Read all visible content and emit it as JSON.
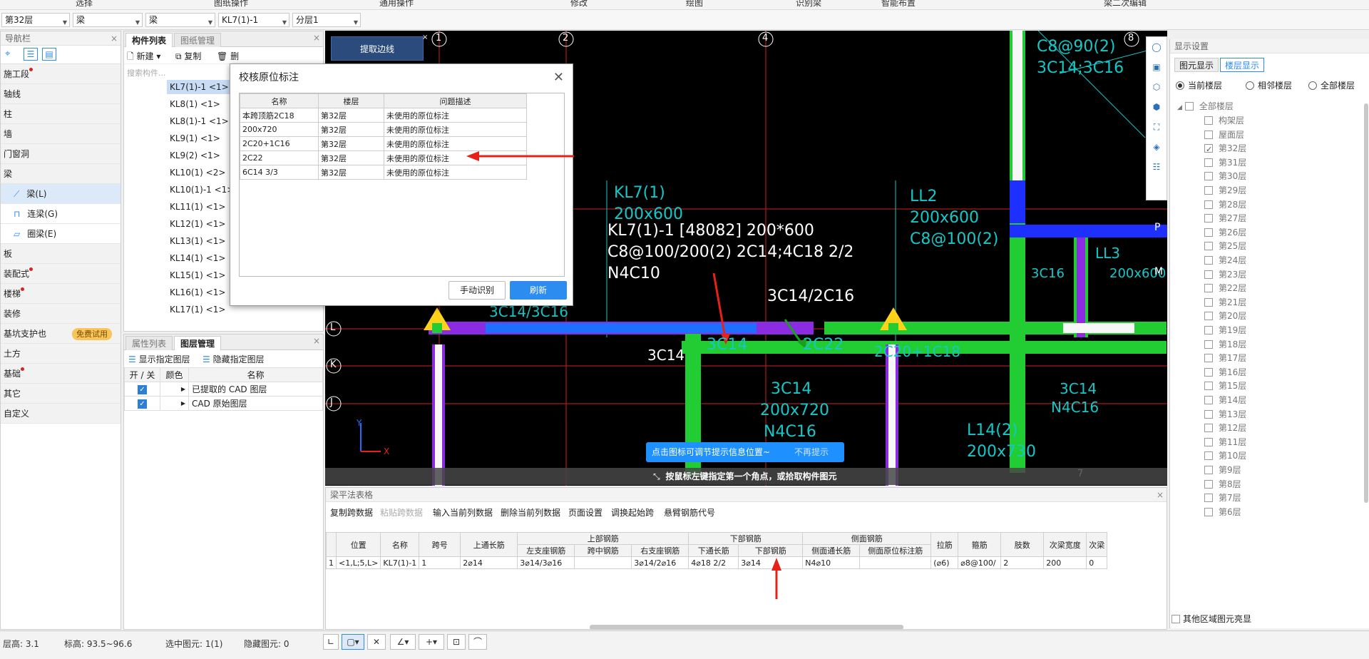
{
  "topmenu": [
    "选择",
    "图纸操作",
    "通用操作",
    "修改",
    "绘图",
    "识别梁",
    "智能布置",
    "梁二次编辑"
  ],
  "selectors": [
    "第32层",
    "梁",
    "梁",
    "KL7(1)-1",
    "分层1"
  ],
  "nav": {
    "title": "导航栏",
    "items": [
      {
        "label": "施工段",
        "dot": true
      },
      {
        "label": "轴线"
      },
      {
        "label": "柱"
      },
      {
        "label": "墙"
      },
      {
        "label": "门窗洞"
      },
      {
        "label": "梁"
      }
    ],
    "beam_sub": [
      "梁(L)",
      "连梁(G)",
      "圈梁(E)"
    ],
    "items2": [
      {
        "label": "板"
      },
      {
        "label": "装配式",
        "dot": true
      },
      {
        "label": "楼梯",
        "dot": true
      },
      {
        "label": "装修"
      },
      {
        "label": "基坑支护也",
        "badge": "免费试用"
      },
      {
        "label": "土方"
      },
      {
        "label": "基础",
        "dot": true
      },
      {
        "label": "其它"
      },
      {
        "label": "自定义"
      }
    ]
  },
  "components": {
    "tabs": [
      "构件列表",
      "图纸管理"
    ],
    "toolbar": {
      "new": "新建",
      "copy": "复制",
      "del": "删"
    },
    "search_placeholder": "搜索构件...",
    "items": [
      "KL7(1)-1 <1>",
      "KL8(1) <1>",
      "KL8(1)-1 <1>",
      "KL9(1) <1>",
      "KL9(2) <1>",
      "KL10(1) <2>",
      "KL10(1)-1 <1>",
      "KL11(1) <1>",
      "KL12(1) <1>",
      "KL13(1) <1>",
      "KL14(1) <1>",
      "KL15(1) <1>",
      "KL16(1) <1>",
      "KL17(1) <1>"
    ]
  },
  "layers": {
    "tabs": [
      "属性列表",
      "图层管理"
    ],
    "show": "显示指定图层",
    "hide": "隐藏指定图层",
    "headers": [
      "开 / 关",
      "颜色",
      "名称"
    ],
    "rows": [
      "已提取的 CAD 图层",
      "CAD 原始图层"
    ]
  },
  "extract_btn": "提取边线",
  "dialog": {
    "title": "校核原位标注",
    "headers": [
      "名称",
      "楼层",
      "问题描述"
    ],
    "rows": [
      [
        "本跨顶筋2C18",
        "第32层",
        "未使用的原位标注"
      ],
      [
        "200x720",
        "第32层",
        "未使用的原位标注"
      ],
      [
        "2C20+1C16",
        "第32层",
        "未使用的原位标注"
      ],
      [
        "2C22",
        "第32层",
        "未使用的原位标注"
      ],
      [
        "6C14 3/3",
        "第32层",
        "未使用的原位标注"
      ]
    ],
    "manual": "手动识别",
    "refresh": "刷新"
  },
  "cad": {
    "axes_top": [
      "1",
      "2",
      "4",
      "8"
    ],
    "axes_left": [
      "L",
      "K",
      "J"
    ],
    "main_label": [
      "KL7(1)-1 [48082] 200*600",
      "C8@100/200(2) 2C14;4C18 2/2",
      "N4C10"
    ],
    "label_3c14_2c16": "3C14/2C16",
    "label_3c14": "3C14",
    "cyan_labels": [
      "KL7(1)",
      "200x600",
      "3C14/3C16",
      "LL2",
      "200x600",
      "C8@100(2)",
      "3C14",
      "2C22",
      "2C20+1C18",
      "3C14",
      "200x720",
      "N4C16",
      "L14(2)",
      "200x730",
      "C8@90(2)",
      "3C14;3C16",
      "LL3",
      "200x600",
      "3C16",
      "3C14",
      "N4C16",
      "P",
      "M",
      "7"
    ]
  },
  "tooltip": {
    "text": "点击图标可调节提示信息位置~",
    "dismiss": "不再提示"
  },
  "hint": "按鼠标左键指定第一个角点，或拾取构件图元",
  "grid": {
    "title": "梁平法表格",
    "toolbar": [
      "复制跨数据",
      "粘贴跨数据",
      "输入当前列数据",
      "删除当前列数据",
      "页面设置",
      "调换起始跨",
      "悬臂钢筋代号"
    ],
    "group_headers": [
      "上部钢筋",
      "下部钢筋",
      "侧面钢筋"
    ],
    "headers": [
      "位置",
      "名称",
      "跨号",
      "上通长筋",
      "左支座钢筋",
      "跨中钢筋",
      "右支座钢筋",
      "下通长筋",
      "下部钢筋",
      "侧面通长筋",
      "侧面原位标注筋",
      "拉筋",
      "箍筋",
      "肢数",
      "次梁宽度",
      "次梁"
    ],
    "row": [
      "<1,L;5,L>",
      "KL7(1)-1",
      "1",
      "2⌀14",
      "3⌀14/3⌀16",
      "",
      "3⌀14/2⌀16",
      "4⌀18 2/2",
      "3⌀14",
      "N4⌀10",
      "",
      "(⌀6)",
      "⌀8@100/",
      "2",
      "200",
      "0"
    ],
    "row_num": "1"
  },
  "display": {
    "title": "显示设置",
    "tabs": [
      "图元显示",
      "楼层显示"
    ],
    "radios": [
      "当前楼层",
      "相邻楼层",
      "全部楼层"
    ],
    "root": "全部楼层",
    "floors": [
      "构架层",
      "屋面层",
      "第32层",
      "第31层",
      "第30层",
      "第29层",
      "第28层",
      "第27层",
      "第26层",
      "第25层",
      "第24层",
      "第23层",
      "第22层",
      "第21层",
      "第20层",
      "第19层",
      "第18层",
      "第17层",
      "第16层",
      "第15层",
      "第14层",
      "第13层",
      "第12层",
      "第11层",
      "第10层",
      "第9层",
      "第8层",
      "第7层",
      "第6层"
    ],
    "checked_floor": "第32层",
    "other": "其他区域图元亮显"
  },
  "status": {
    "floor_height": "层高:  3.1",
    "elevation": "标高:  93.5~96.6",
    "selected": "选中图元: 1(1)",
    "hidden": "隐藏图元: 0"
  }
}
